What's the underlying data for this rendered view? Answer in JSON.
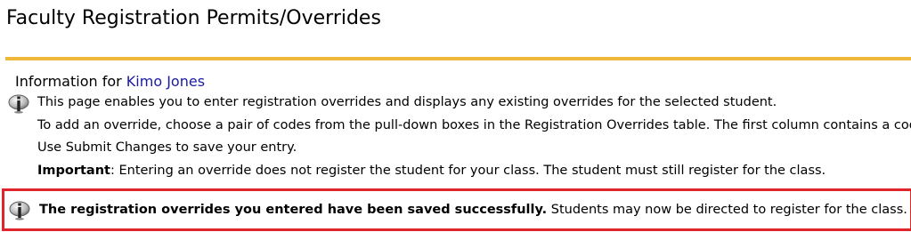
{
  "page": {
    "title": "Faculty Registration Permits/Overrides"
  },
  "info": {
    "prefix": "Information for ",
    "student_name": "Kimo Jones",
    "lines": [
      "This page enables you to enter registration overrides and displays any existing overrides for the selected student.",
      "To add an override, choose a pair of codes from the pull-down boxes in the Registration Overrides table. The first column contains a code",
      "Use Submit Changes to save your entry."
    ],
    "important_label": "Important",
    "important_text": ": Entering an override does not register the student for your class. The student must still register for the class."
  },
  "success": {
    "bold": "The registration overrides you entered have been saved successfully.",
    "text": " Students may now be directed to register for the class."
  },
  "colors": {
    "rule": "#f0b83a",
    "link": "#1a1aa6",
    "success_border": "#e0242c"
  }
}
